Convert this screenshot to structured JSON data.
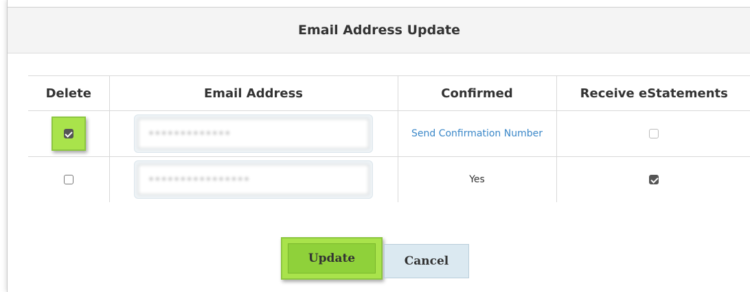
{
  "dialog": {
    "title": "Email Address Update"
  },
  "table": {
    "headers": {
      "delete": "Delete",
      "email": "Email Address",
      "confirmed": "Confirmed",
      "estatements": "Receive eStatements"
    },
    "rows": [
      {
        "delete_checked": true,
        "email": "•••••••••••••",
        "confirmed": "Send Confirmation Number",
        "confirmed_is_link": true,
        "estatements_checked": false
      },
      {
        "delete_checked": false,
        "email": "••••••••••••••••",
        "confirmed": "Yes",
        "confirmed_is_link": false,
        "estatements_checked": true
      }
    ]
  },
  "buttons": {
    "update": "Update",
    "cancel": "Cancel"
  },
  "colors": {
    "highlight": "#a9e34b",
    "link": "#3a87c8",
    "cancel_bg": "#dbe9f1"
  }
}
